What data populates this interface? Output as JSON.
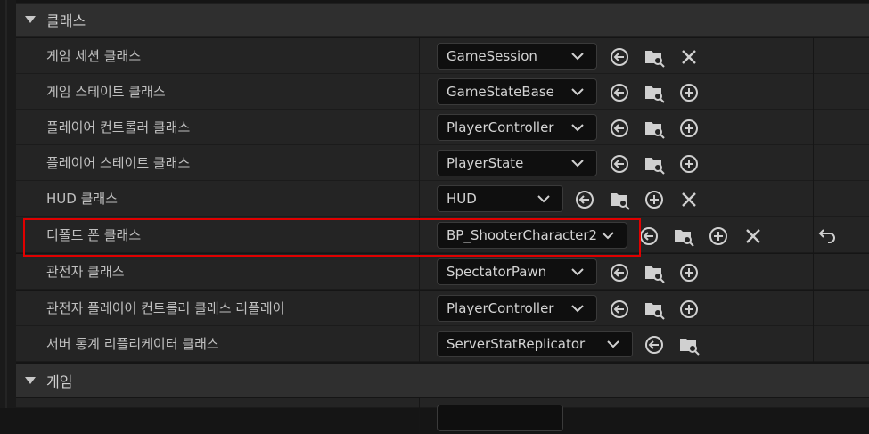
{
  "sections": [
    {
      "title": "클래스"
    },
    {
      "title": "게임"
    }
  ],
  "rows": [
    {
      "label": "게임 세션 클래스",
      "value": "GameSession"
    },
    {
      "label": "게임 스테이트 클래스",
      "value": "GameStateBase"
    },
    {
      "label": "플레이어 컨트롤러 클래스",
      "value": "PlayerController"
    },
    {
      "label": "플레이어 스테이트 클래스",
      "value": "PlayerState"
    },
    {
      "label": "HUD 클래스",
      "value": "HUD"
    },
    {
      "label": "디폴트 폰 클래스",
      "value": "BP_ShooterCharacter2"
    },
    {
      "label": "관전자 클래스",
      "value": "SpectatorPawn"
    },
    {
      "label": "관전자 플레이어 컨트롤러 클래스 리플레이",
      "value": "PlayerController"
    },
    {
      "label": "서버 통계 리플리케이터 클래스",
      "value": "ServerStatReplicator"
    }
  ],
  "colors": {
    "highlight": "#e00000",
    "row_bg": "#242424",
    "header_bg": "#2f2f2f"
  }
}
